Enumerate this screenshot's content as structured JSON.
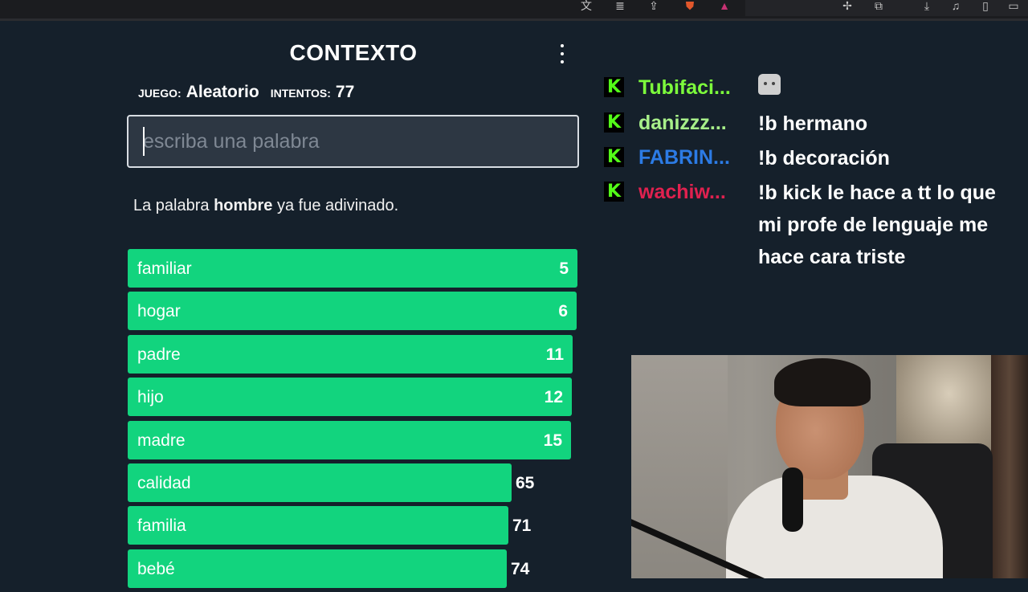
{
  "browser": {
    "toolbar_icons": [
      "translate-icon",
      "reader-icon",
      "share-icon",
      "brave-shield-icon",
      "rewards-icon",
      "extensions-icon",
      "screenshot-icon",
      "download-icon",
      "media-icon",
      "sidebar-icon",
      "window-icon"
    ]
  },
  "game": {
    "title": "CONTEXTO",
    "menu_icon": "kebab-menu-icon",
    "game_label": "JUEGO:",
    "game_value": "Aleatorio",
    "attempts_label": "INTENTOS:",
    "attempts_value": "77",
    "input_placeholder": "escriba una palabra",
    "message_prefix": "La palabra",
    "message_word": "hombre",
    "message_suffix": "ya fue adivinado.",
    "accent_color": "#12d47e",
    "guesses": [
      {
        "word": "familiar",
        "rank": "5",
        "fill": 1.0
      },
      {
        "word": "hogar",
        "rank": "6",
        "fill": 0.998
      },
      {
        "word": "padre",
        "rank": "11",
        "fill": 0.99
      },
      {
        "word": "hijo",
        "rank": "12",
        "fill": 0.988
      },
      {
        "word": "madre",
        "rank": "15",
        "fill": 0.985
      },
      {
        "word": "calidad",
        "rank": "65",
        "fill": 0.925
      },
      {
        "word": "familia",
        "rank": "71",
        "fill": 0.918
      },
      {
        "word": "bebé",
        "rank": "74",
        "fill": 0.915
      }
    ]
  },
  "chat": {
    "badge_letter": "K",
    "messages": [
      {
        "user": "Tubifaci...",
        "color": "#7dfc3c",
        "text": "",
        "emote": "cat-emote-icon"
      },
      {
        "user": "danizzz...",
        "color": "#a8f08a",
        "text": "!b hermano"
      },
      {
        "user": "FABRIN...",
        "color": "#2c7be5",
        "text": "!b decoración"
      },
      {
        "user": "wachiw...",
        "color": "#e0214f",
        "text": "!b kick le hace a tt lo que mi profe de lenguaje me hace cara triste"
      }
    ]
  }
}
